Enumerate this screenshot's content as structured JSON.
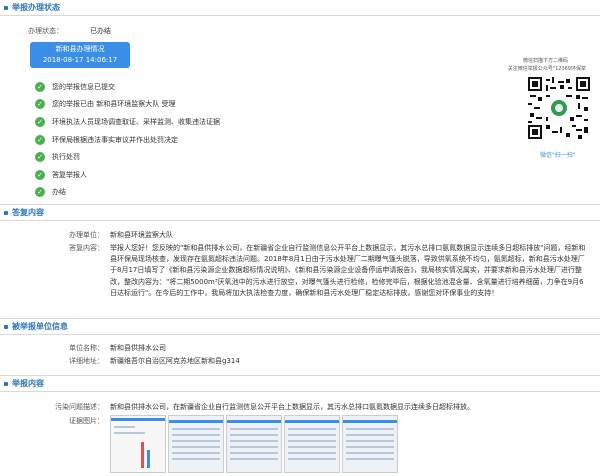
{
  "sections": {
    "processing": "举报办理状态",
    "reply": "答复内容",
    "reported_unit": "被举报单位信息",
    "report": "举报内容"
  },
  "status": {
    "label": "办理状态：",
    "value": "已办结",
    "box_title": "新和县办理情况",
    "box_time": "2018-08-17 14:06:17"
  },
  "timeline": [
    "您的举报信息已提交",
    "您的举报已由 新和县环境监察大队 受理",
    "环境执法人员现场调查取证、采样监测、收集违法证据",
    "环保局根据违法事实审议并作出处罚决定",
    "执行处罚",
    "答复举报人",
    "办结"
  ],
  "qr": {
    "caption1": "微信扫描下方二维码",
    "caption2": "关注微信举报公众号\"12369环保举",
    "link": "微信\"扫一扫\""
  },
  "reply": {
    "unit_label": "办理单位：",
    "unit_value": "新和县环境监察大队",
    "content_label": "答复内容：",
    "content_value": "举报人您好！您反映的\"新和县供排水公司，在新疆省企业自行监测信息公开平台上数据显示，其污水总排口氨氮数据显示连续多日超标排放\"问题，经新和县环保局现场核查，发现存在氨氮超标违法问题。2018年8月1日由于污水处理厂二期曝气篷头脱落，导致供氧系统不均匀，氨氮超标，新和县污水处理厂于8月17日填写了《新和县污染源企业数据超标情况说明》、《新和县污染源企业设备停运申请报告》，我局核实情况属实，并要求新和县污水处理厂进行整改，整改内容为：\"将二期5000m³厌氧池中的污水进行放空，对曝气篷头进行检修，检修完毕后，根据化验池混含量、含氧量进行培养细菌，力争在9月6日达标运行\"。在今后的工作中，我局将加大执法检查力度，确保新和县污水处理厂稳定达标排放，感谢您对环保事业的支持！"
  },
  "reported_unit": {
    "name_label": "单位名称：",
    "name_value": "新和县供排水公司",
    "address_label": "详细地址：",
    "address_value": "新疆维吾尔自治区阿克苏地区新和县g314"
  },
  "report": {
    "desc_label": "污染问题描述：",
    "desc_value": "新和县供排水公司，在新疆省企业自行监测信息公开平台上数据显示，其污水总排口氨氮数据显示连续多日超标排放。",
    "images_label": "证据图片："
  },
  "colors": {
    "accent": "#2e75b6",
    "status_box": "#3a8ee6",
    "done": "#4caf50"
  }
}
